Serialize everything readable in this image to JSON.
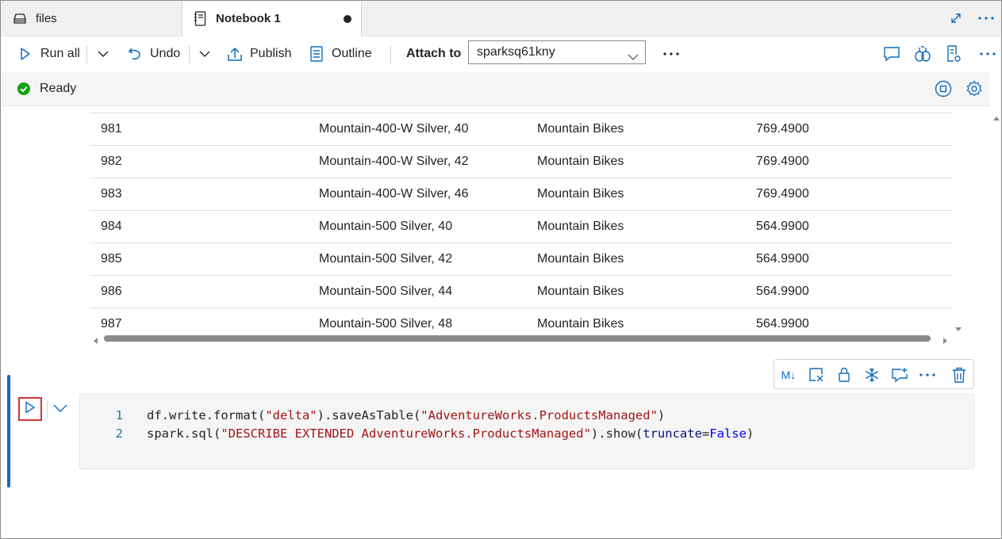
{
  "tabs": [
    {
      "label": "files"
    },
    {
      "label": "Notebook 1"
    }
  ],
  "toolbar": {
    "run_all": "Run all",
    "undo": "Undo",
    "publish": "Publish",
    "outline": "Outline",
    "attach_to": "Attach to",
    "spark_pool": "sparksq61kny",
    "more": "···"
  },
  "status": {
    "text": "Ready",
    "color": "#13a10e"
  },
  "accent_color": "#0f6cbd",
  "output_table": {
    "rows": [
      [
        "981",
        "Mountain-400-W Silver, 40",
        "Mountain Bikes",
        "769.4900"
      ],
      [
        "982",
        "Mountain-400-W Silver, 42",
        "Mountain Bikes",
        "769.4900"
      ],
      [
        "983",
        "Mountain-400-W Silver, 46",
        "Mountain Bikes",
        "769.4900"
      ],
      [
        "984",
        "Mountain-500 Silver, 40",
        "Mountain Bikes",
        "564.9900"
      ],
      [
        "985",
        "Mountain-500 Silver, 42",
        "Mountain Bikes",
        "564.9900"
      ],
      [
        "986",
        "Mountain-500 Silver, 44",
        "Mountain Bikes",
        "564.9900"
      ],
      [
        "987",
        "Mountain-500 Silver, 48",
        "Mountain Bikes",
        "564.9900"
      ]
    ]
  },
  "cell_toolbar": {
    "markdown": "M↓",
    "more": "···"
  },
  "code_cell": {
    "lines": [
      {
        "num": "1",
        "parts": [
          {
            "t": "df.write.format(",
            "c": ""
          },
          {
            "t": "\"delta\"",
            "c": "str"
          },
          {
            "t": ").saveAsTable(",
            "c": ""
          },
          {
            "t": "\"AdventureWorks.ProductsManaged\"",
            "c": "str"
          },
          {
            "t": ")",
            "c": ""
          }
        ]
      },
      {
        "num": "2",
        "parts": [
          {
            "t": "spark.sql(",
            "c": ""
          },
          {
            "t": "\"DESCRIBE EXTENDED AdventureWorks.ProductsManaged\"",
            "c": "str"
          },
          {
            "t": ").show(",
            "c": ""
          },
          {
            "t": "truncate",
            "c": "param"
          },
          {
            "t": "=",
            "c": ""
          },
          {
            "t": "False",
            "c": "kw"
          },
          {
            "t": ")",
            "c": ""
          }
        ]
      }
    ]
  }
}
